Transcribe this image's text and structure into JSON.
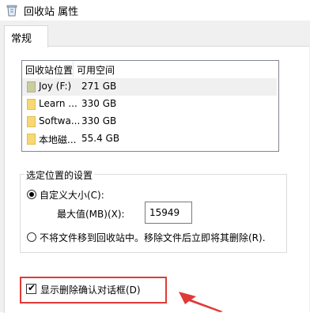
{
  "window": {
    "title": "回收站 属性",
    "icon": "recycle-bin-icon"
  },
  "tabs": [
    {
      "label": "常规",
      "selected": true
    }
  ],
  "drive_list": {
    "columns": [
      "回收站位置",
      "可用空间"
    ],
    "rows": [
      {
        "name": "Joy (F:)",
        "space": "271 GB",
        "icon": "system-drive-icon",
        "selected": true
      },
      {
        "name": "Learn ...",
        "space": "330 GB",
        "icon": "drive-folder-icon",
        "selected": false
      },
      {
        "name": "Softwa...",
        "space": "330 GB",
        "icon": "drive-folder-icon",
        "selected": false
      },
      {
        "name": "本地磁...",
        "space": "55.4 GB",
        "icon": "drive-folder-icon",
        "selected": false
      }
    ]
  },
  "settings": {
    "group_label": "选定位置的设置",
    "custom_size": {
      "label": "自定义大小(C):",
      "selected": true
    },
    "max_size": {
      "label": "最大值(MB)(X):",
      "value": "15949"
    },
    "no_recycle": {
      "label": "不将文件移到回收站中。移除文件后立即将其删除(R).",
      "selected": false
    }
  },
  "confirm_delete": {
    "label": "显示删除确认对话框(D)",
    "checked": true
  },
  "annotation": {
    "highlight_color": "#e03a37"
  }
}
